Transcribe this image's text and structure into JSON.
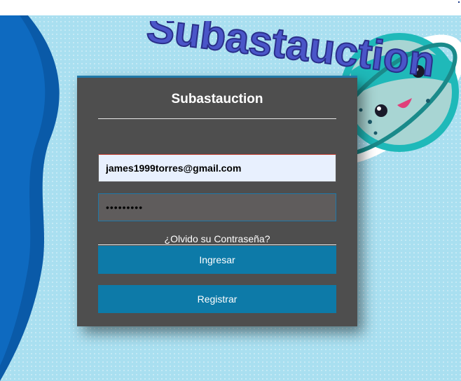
{
  "background": {
    "brand_text": "Subastauction",
    "colors": {
      "sky": "#a9dff0",
      "wave": "#0a5aa8",
      "planet": "#1fb9b9",
      "text": "#4a55c8"
    }
  },
  "login": {
    "title": "Subastauction",
    "email_value": "james1999torres@gmail.com",
    "password_mask": "•••••••••",
    "forgot_label": "¿Olvido su Contraseña?",
    "login_label": "Ingresar",
    "register_label": "Registrar"
  }
}
